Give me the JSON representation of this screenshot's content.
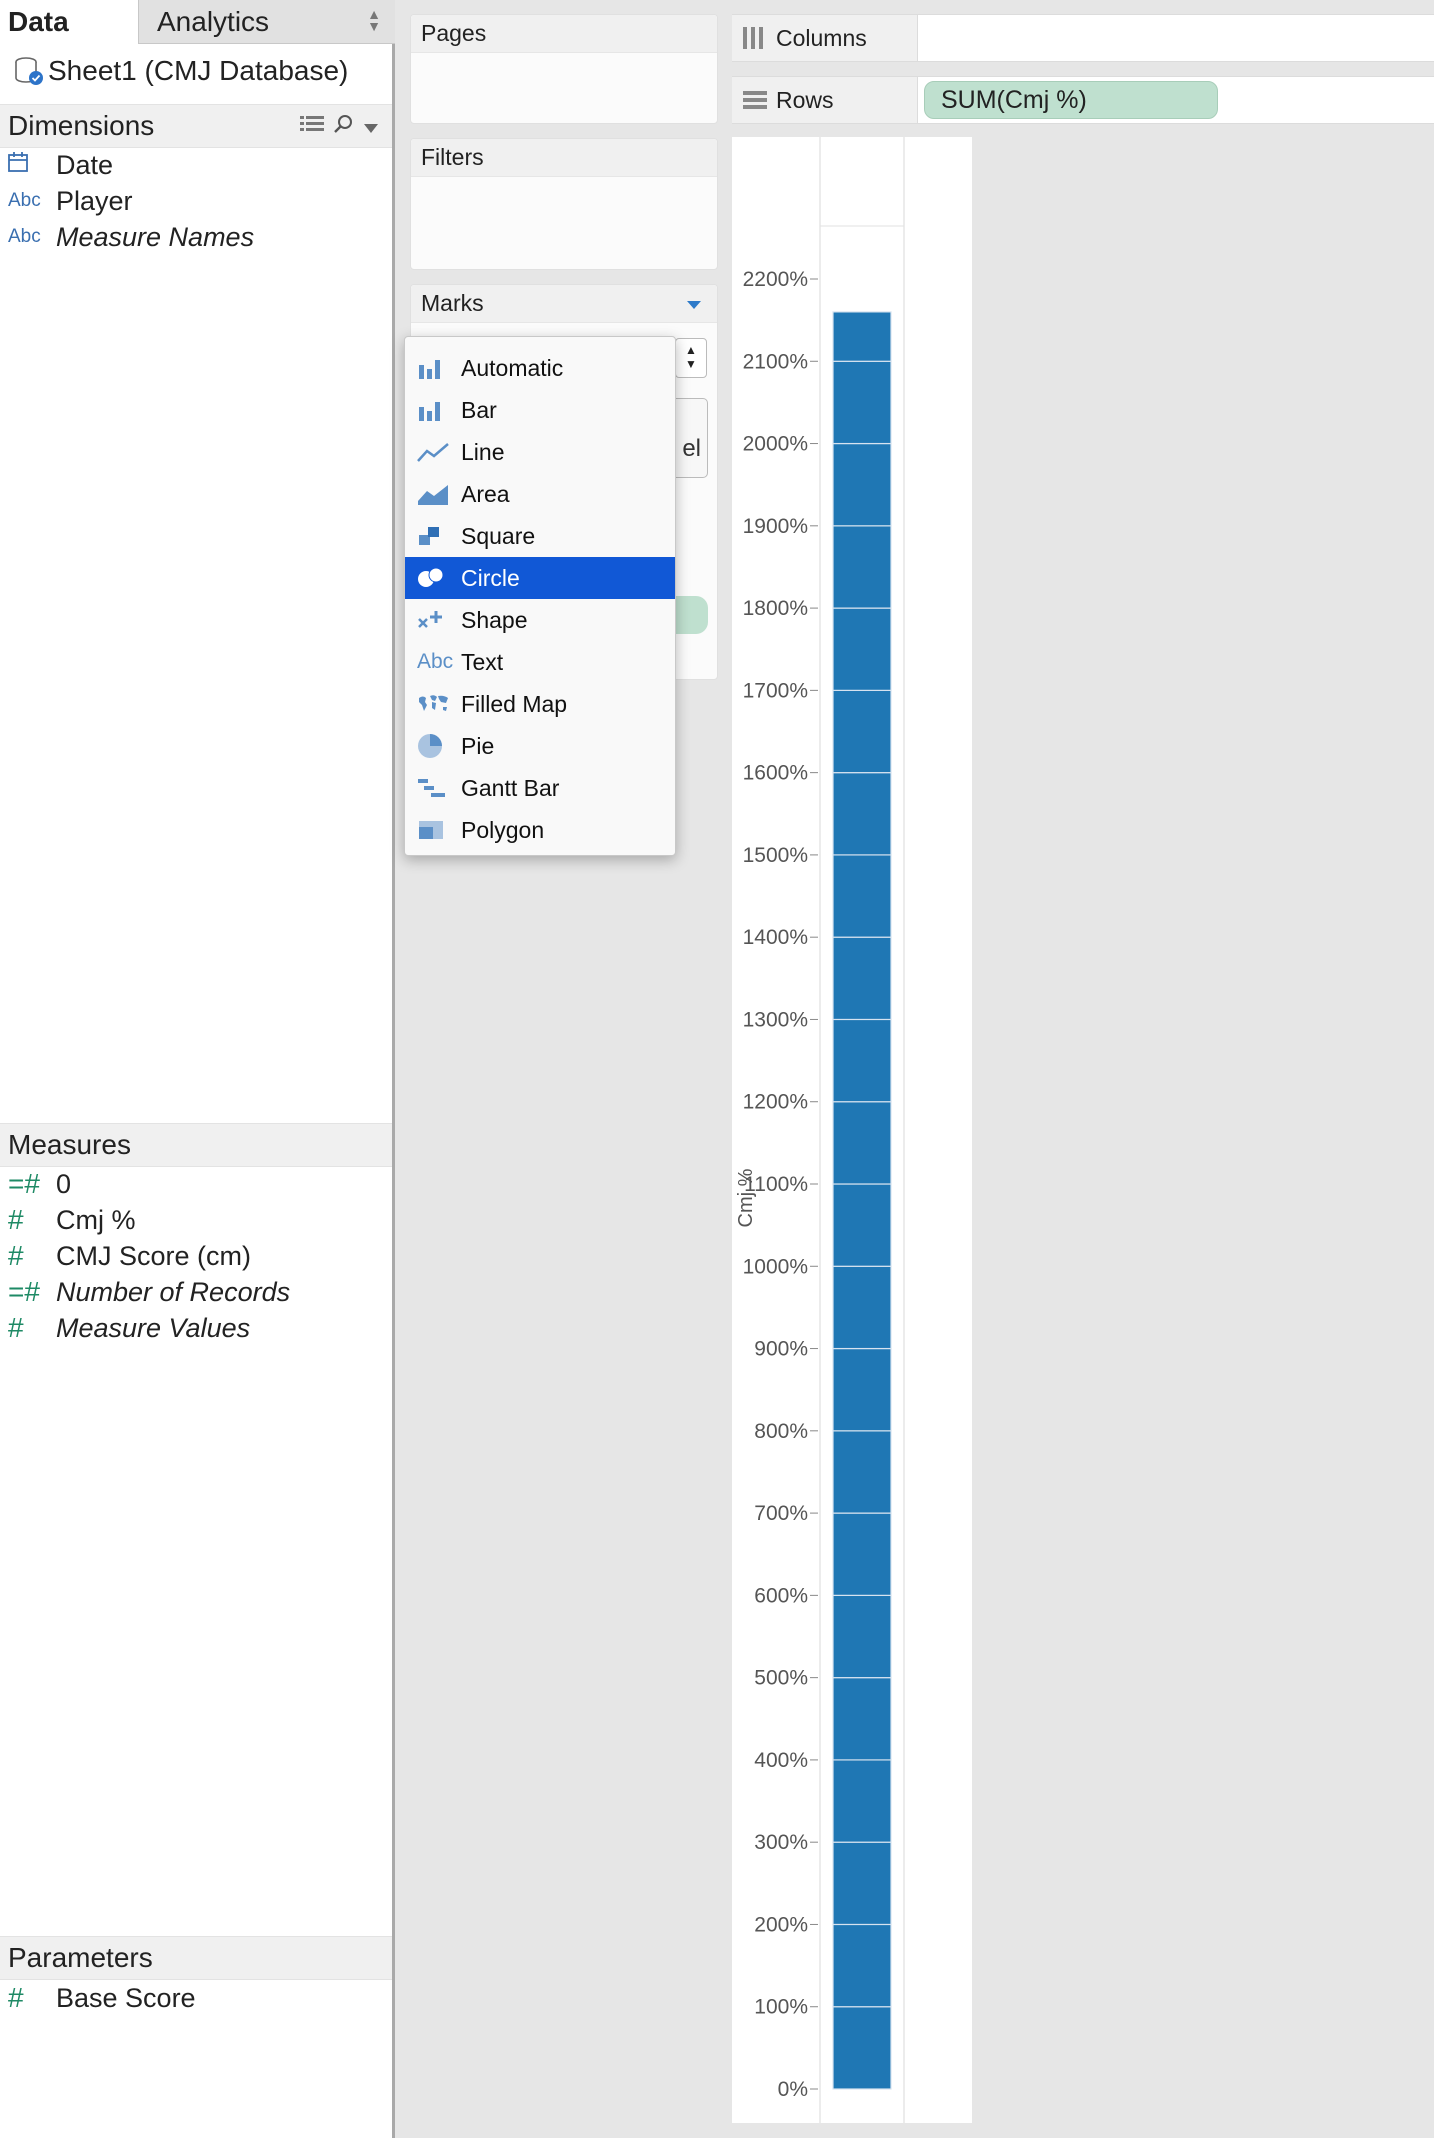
{
  "tabs": {
    "data": "Data",
    "analytics": "Analytics"
  },
  "datasource": {
    "name": "Sheet1 (CMJ Database)"
  },
  "dimensions": {
    "header": "Dimensions",
    "fields": [
      {
        "icon": "calendar-icon",
        "type_label": "",
        "name": "Date",
        "italic": false
      },
      {
        "icon": "abc-icon",
        "type_label": "Abc",
        "name": "Player",
        "italic": false
      },
      {
        "icon": "abc-icon",
        "type_label": "Abc",
        "name": "Measure Names",
        "italic": true
      }
    ]
  },
  "measures": {
    "header": "Measures",
    "fields": [
      {
        "icon": "calc-measure-icon",
        "name": "0",
        "italic": false
      },
      {
        "icon": "measure-icon",
        "name": "Cmj %",
        "italic": false
      },
      {
        "icon": "measure-icon",
        "name": "CMJ Score (cm)",
        "italic": false
      },
      {
        "icon": "calc-measure-icon",
        "name": "Number of Records",
        "italic": true
      },
      {
        "icon": "measure-icon",
        "name": "Measure Values",
        "italic": true
      }
    ]
  },
  "parameters": {
    "header": "Parameters",
    "fields": [
      {
        "icon": "measure-icon",
        "name": "Base Score",
        "italic": false
      }
    ]
  },
  "cards": {
    "pages": "Pages",
    "filters": "Filters",
    "marks": "Marks"
  },
  "marks_peek": {
    "label_fragment": "el"
  },
  "mark_menu": {
    "selected": "Circle",
    "items": [
      {
        "icon": "bar-icon",
        "label": "Automatic"
      },
      {
        "icon": "bar-icon",
        "label": "Bar"
      },
      {
        "icon": "line-icon",
        "label": "Line"
      },
      {
        "icon": "area-icon",
        "label": "Area"
      },
      {
        "icon": "square-icon",
        "label": "Square"
      },
      {
        "icon": "circle-icon",
        "label": "Circle"
      },
      {
        "icon": "shape-icon",
        "label": "Shape"
      },
      {
        "icon": "text-icon",
        "label": "Text",
        "glyph": "Abc"
      },
      {
        "icon": "filled-map-icon",
        "label": "Filled Map"
      },
      {
        "icon": "pie-icon",
        "label": "Pie"
      },
      {
        "icon": "gantt-bar-icon",
        "label": "Gantt Bar"
      },
      {
        "icon": "polygon-icon",
        "label": "Polygon"
      }
    ]
  },
  "shelves": {
    "columns": {
      "label": "Columns",
      "pills": []
    },
    "rows": {
      "label": "Rows",
      "pills": [
        "SUM(Cmj %)"
      ]
    }
  },
  "colors": {
    "bar": "#1f77b4",
    "pill": "#bfe0cf",
    "selected": "#1158d6",
    "measure_icon": "#1e8a65",
    "dimension_icon": "#3a6fb0"
  },
  "chart_data": {
    "type": "bar",
    "categories": [
      ""
    ],
    "series": [
      {
        "name": "SUM(Cmj %)",
        "segments": [
          100,
          100,
          100,
          100,
          100,
          100,
          100,
          100,
          100,
          100,
          100,
          100,
          100,
          100,
          100,
          100,
          100,
          100,
          100,
          100,
          100,
          100
        ],
        "total": 2160
      }
    ],
    "ylabel": "Cmj %",
    "ylim": [
      0,
      2200
    ],
    "yticks": [
      0,
      100,
      200,
      300,
      400,
      500,
      600,
      700,
      800,
      900,
      1000,
      1100,
      1200,
      1300,
      1400,
      1500,
      1600,
      1700,
      1800,
      1900,
      2000,
      2100,
      2200
    ],
    "tick_suffix": "%",
    "grid": false
  }
}
